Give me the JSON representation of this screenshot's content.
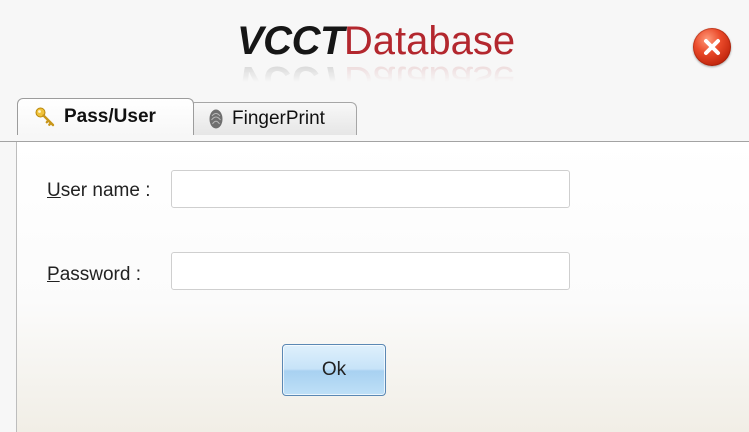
{
  "window": {
    "title_part1": "VCCT",
    "title_part2": "Database"
  },
  "tabs": [
    {
      "label": "Pass/User",
      "icon": "key-icon",
      "active": true
    },
    {
      "label": "FingerPrint",
      "icon": "fingerprint-icon",
      "active": false
    }
  ],
  "form": {
    "username_label_accesskey": "U",
    "username_label_rest": "ser name :",
    "username_value": "",
    "password_label_accesskey": "P",
    "password_label_rest": "assword :",
    "password_value": "",
    "ok_label": "Ok"
  },
  "colors": {
    "title_dark": "#161616",
    "title_red": "#b3272e",
    "close_red": "#d8371b",
    "ok_blue": "#c7e3f8"
  }
}
